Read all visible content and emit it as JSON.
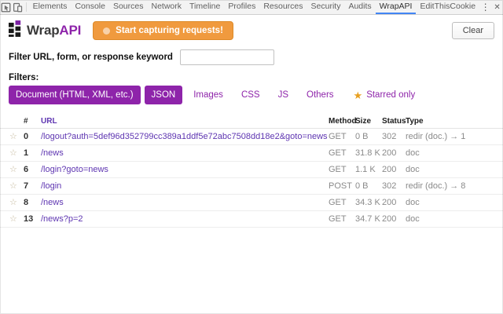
{
  "colors": {
    "purple": "#8e24aa",
    "orange": "#f09a3e",
    "link": "#5e35b1",
    "gold": "#e8a020",
    "tab-accent": "#4285f4"
  },
  "devtools": {
    "tabs": [
      {
        "label": "Elements",
        "active": false
      },
      {
        "label": "Console",
        "active": false
      },
      {
        "label": "Sources",
        "active": false
      },
      {
        "label": "Network",
        "active": false
      },
      {
        "label": "Timeline",
        "active": false
      },
      {
        "label": "Profiles",
        "active": false
      },
      {
        "label": "Resources",
        "active": false
      },
      {
        "label": "Security",
        "active": false
      },
      {
        "label": "Audits",
        "active": false
      },
      {
        "label": "WrapAPI",
        "active": true
      },
      {
        "label": "EditThisCookie",
        "active": false
      }
    ],
    "menu_glyph": "⋮",
    "close_glyph": "✕"
  },
  "header": {
    "logo_wrap": "Wrap",
    "logo_api": "API",
    "capture_button_label": "Start capturing requests!",
    "clear_button_label": "Clear"
  },
  "filter": {
    "label": "Filter URL, form, or response keyword",
    "value": ""
  },
  "filters": {
    "heading": "Filters:",
    "buttons": [
      {
        "label": "Document (HTML, XML, etc.)",
        "active": true
      },
      {
        "label": "JSON",
        "active": true
      },
      {
        "label": "Images",
        "active": false
      },
      {
        "label": "CSS",
        "active": false
      },
      {
        "label": "JS",
        "active": false
      },
      {
        "label": "Others",
        "active": false
      }
    ],
    "starred_only_label": "Starred only"
  },
  "icons": {
    "star_outline": "☆",
    "star_filled": "★"
  },
  "table": {
    "headers": {
      "num": "#",
      "url": "URL",
      "method": "Method",
      "size": "Size",
      "status": "Status",
      "type": "Type"
    },
    "rows": [
      {
        "num": "0",
        "url": "/logout?auth=5def96d352799cc389a1ddf5e72abc7508dd18e2&goto=news",
        "method": "GET",
        "size": "0 B",
        "status": "302",
        "type": "redir (doc.) → 1"
      },
      {
        "num": "1",
        "url": "/news",
        "method": "GET",
        "size": "31.8 K",
        "status": "200",
        "type": "doc"
      },
      {
        "num": "6",
        "url": "/login?goto=news",
        "method": "GET",
        "size": "1.1 K",
        "status": "200",
        "type": "doc"
      },
      {
        "num": "7",
        "url": "/login",
        "method": "POST",
        "size": "0 B",
        "status": "302",
        "type": "redir (doc.) → 8"
      },
      {
        "num": "8",
        "url": "/news",
        "method": "GET",
        "size": "34.3 K",
        "status": "200",
        "type": "doc"
      },
      {
        "num": "13",
        "url": "/news?p=2",
        "method": "GET",
        "size": "34.7 K",
        "status": "200",
        "type": "doc"
      }
    ]
  }
}
